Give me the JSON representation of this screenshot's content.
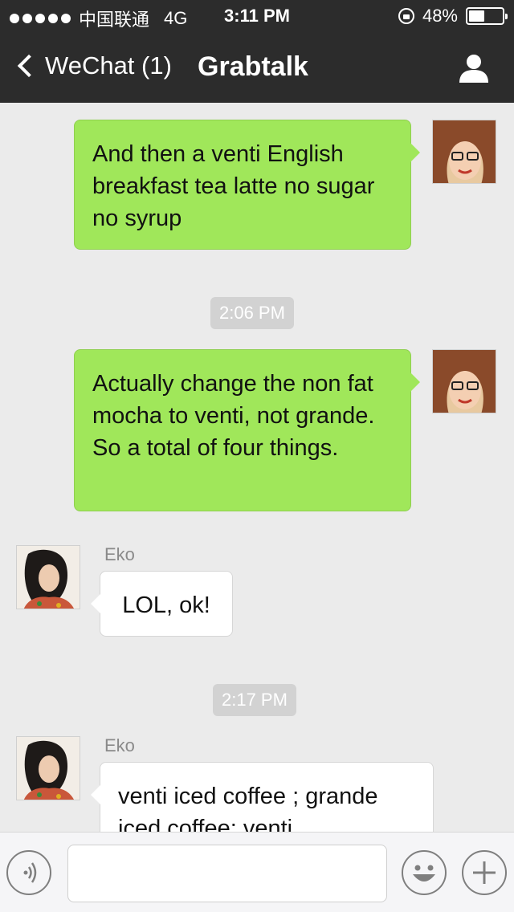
{
  "status_bar": {
    "carrier": "中国联通",
    "network": "4G",
    "time": "3:11 PM",
    "battery_percent": "48%",
    "battery_level": 0.48
  },
  "navbar": {
    "back_label": "WeChat (1)",
    "title": "Grabtalk"
  },
  "messages": [
    {
      "direction": "outgoing",
      "text": "And then a venti English breakfast tea latte no sugar no syrup"
    },
    {
      "type": "timestamp",
      "text": "2:06 PM"
    },
    {
      "direction": "outgoing",
      "text": "Actually change the non fat mocha to venti, not grande. So a total of four things."
    },
    {
      "direction": "incoming",
      "sender": "Eko",
      "text": "LOL, ok!"
    },
    {
      "type": "timestamp",
      "text": "2:17 PM"
    },
    {
      "direction": "incoming",
      "sender": "Eko",
      "text": "venti iced coffee ; grande iced coffee; venti"
    }
  ],
  "input_bar": {
    "placeholder": "",
    "value": ""
  },
  "colors": {
    "outgoing_bubble": "#a0e75a",
    "incoming_bubble": "#ffffff",
    "header": "#2c2c2c",
    "background": "#ebebeb"
  },
  "icons": {
    "back": "chevron-left-icon",
    "profile": "person-icon",
    "voice": "voice-icon",
    "emoji": "emoji-icon",
    "add": "plus-icon",
    "lock": "rotation-lock-icon",
    "battery": "battery-icon"
  }
}
